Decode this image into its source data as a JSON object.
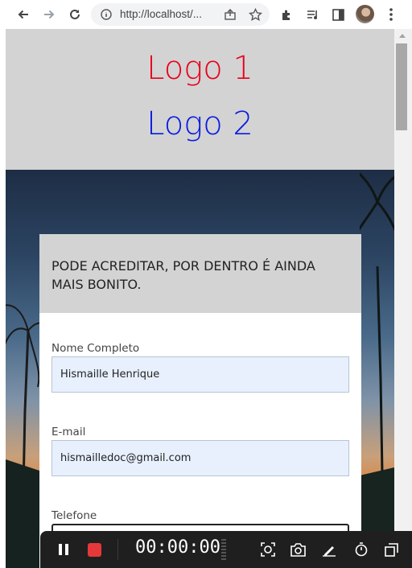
{
  "browser": {
    "url": "http://localhost/...",
    "nav": {
      "back_icon": "arrow-left-icon",
      "forward_icon": "arrow-right-icon",
      "reload_icon": "reload-icon"
    },
    "actions": [
      "share-icon",
      "star-icon",
      "extensions-icon",
      "media-icon",
      "sidebar-icon",
      "avatar",
      "kebab-menu-icon"
    ]
  },
  "header": {
    "logo1": "Logo 1",
    "logo2": "Logo 2",
    "logo1_color": "#e8001c",
    "logo2_color": "#0a1be0"
  },
  "form": {
    "title": "PODE ACREDITAR, POR DENTRO É AINDA MAIS BONITO.",
    "fields": [
      {
        "label": "Nome Completo",
        "value": "Hismaille Henrique"
      },
      {
        "label": "E-mail",
        "value": "hismailledoc@gmail.com"
      },
      {
        "label": "Telefone",
        "value": ""
      }
    ]
  },
  "recorder": {
    "timer": "00:00:00",
    "record_color": "#e5383b"
  }
}
